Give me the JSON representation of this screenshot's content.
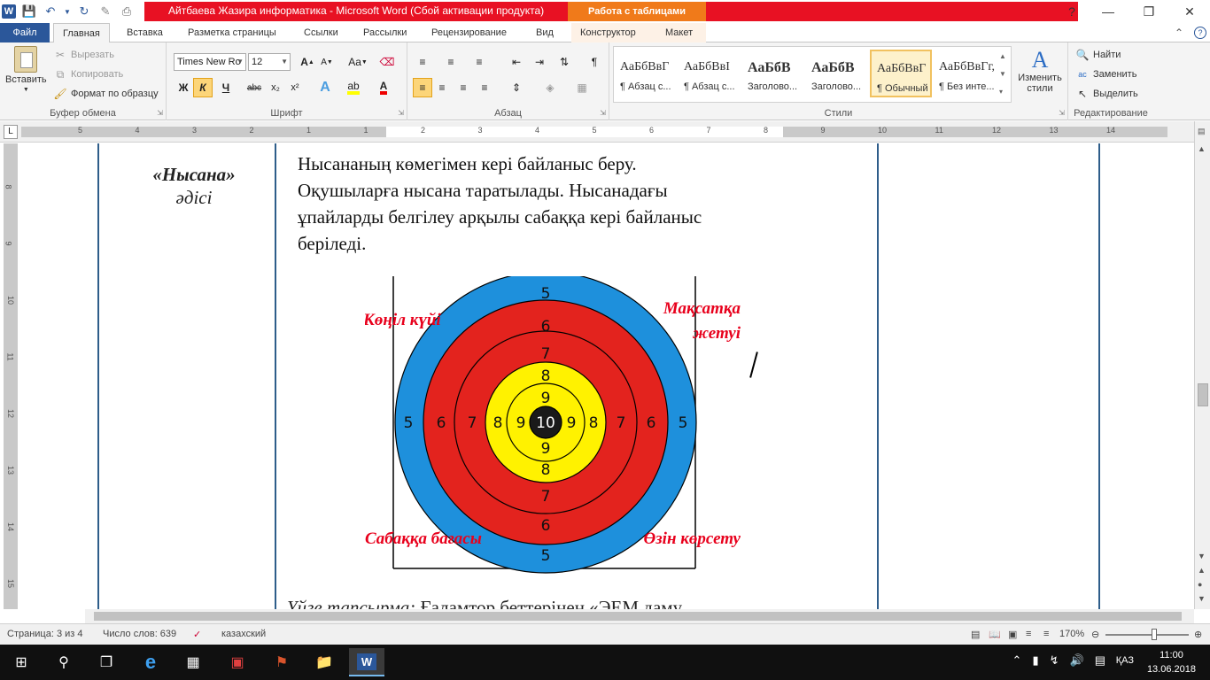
{
  "window": {
    "title": "Айтбаева Жазира информатика  -  Microsoft Word (Сбой активации продукта)",
    "contextual_title": "Работа с таблицами",
    "quick_access": [
      "save-icon",
      "undo-icon",
      "redo-icon",
      "format-painter-icon",
      "print-icon"
    ]
  },
  "tabs": {
    "file": "Файл",
    "home": "Главная",
    "insert": "Вставка",
    "layout": "Разметка страницы",
    "references": "Ссылки",
    "mailings": "Рассылки",
    "review": "Рецензирование",
    "view": "Вид",
    "design": "Конструктор",
    "table_layout": "Макет"
  },
  "ribbon": {
    "clipboard": {
      "label": "Буфер обмена",
      "paste": "Вставить",
      "cut": "Вырезать",
      "copy": "Копировать",
      "format_painter": "Формат по образцу"
    },
    "font": {
      "label": "Шрифт",
      "font_name": "Times New Ro",
      "font_size": "12",
      "bold": "Ж",
      "italic": "К",
      "underline": "Ч",
      "strike": "abc",
      "subscript": "x₂",
      "superscript": "x²",
      "grow": "A",
      "shrink": "A",
      "change_case": "Aa"
    },
    "paragraph": {
      "label": "Абзац"
    },
    "styles": {
      "label": "Стили",
      "items": [
        {
          "sample": "АаБбВвГ",
          "name": "¶ Абзац с..."
        },
        {
          "sample": "АаБбВвI",
          "name": "¶ Абзац с..."
        },
        {
          "sample": "АаБбВ",
          "name": "Заголово..."
        },
        {
          "sample": "АаБбВ",
          "name": "Заголово..."
        },
        {
          "sample": "АаБбВвГ",
          "name": "¶ Обычный"
        },
        {
          "sample": "АаБбВвГг,",
          "name": "¶ Без инте..."
        }
      ],
      "change_styles": "Изменить стили"
    },
    "editing": {
      "label": "Редактирование",
      "find": "Найти",
      "replace": "Заменить",
      "select": "Выделить"
    }
  },
  "ruler": {
    "h_numbers": [
      "5",
      "4",
      "3",
      "2",
      "1",
      "1",
      "2",
      "3",
      "4",
      "5",
      "6",
      "7",
      "8",
      "9",
      "10",
      "11",
      "12",
      "13",
      "14"
    ],
    "v_numbers": [
      "8",
      "9",
      "10",
      "11",
      "12",
      "13",
      "14",
      "15"
    ]
  },
  "document": {
    "method_title": "«Нысана»",
    "method_subtitle": "әдісі",
    "body_lines": [
      "Нысананың көмегімен кері байланыс беру.",
      "Оқушыларға нысана таратылады. Нысанадағы",
      "ұпайларды белгілеу арқылы сабаққа кері байланыс",
      "беріледі."
    ],
    "target": {
      "labels": {
        "top_left": "Көңіл күйі",
        "top_right_1": "Мақсатқа",
        "top_right_2": "жетуі",
        "bottom_left": "Сабаққа бағасы",
        "bottom_right": "Өзін көрсету"
      },
      "rings": [
        "5",
        "6",
        "7",
        "8",
        "9",
        "10"
      ],
      "colors": {
        "blue": "#1E90DC",
        "red": "#E3231E",
        "yellow": "#FFF200",
        "center": "#1a1a1a",
        "label_red": "#E8001C"
      }
    },
    "homework_label": "Үйге тапсырма:",
    "homework_text": " Ғаламтор беттерінен «ЭЕМ даму"
  },
  "status": {
    "page": "Страница: 3 из 4",
    "words": "Число слов: 639",
    "language": "казахский",
    "zoom": "170%"
  },
  "taskbar": {
    "lang": "ҚАЗ",
    "time": "11:00",
    "date": "13.06.2018"
  }
}
